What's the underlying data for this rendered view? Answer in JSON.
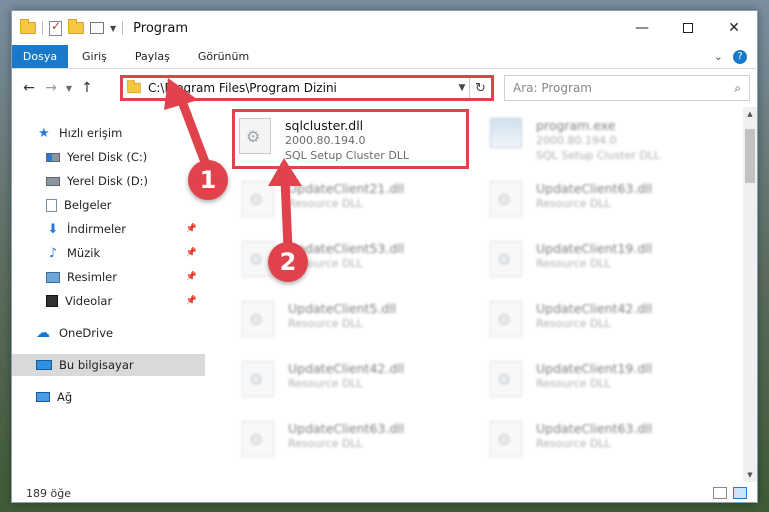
{
  "window": {
    "title": "Program",
    "minimize": "—",
    "close": "✕"
  },
  "ribbon": {
    "tabs": [
      "Dosya",
      "Giriş",
      "Paylaş",
      "Görünüm"
    ],
    "expand_icon": "chevron-down-icon",
    "help_label": "?"
  },
  "address": {
    "path": "C:\\Program Files\\Program Dizini",
    "back": "←",
    "forward": "→",
    "recent": "▼",
    "up": "↑",
    "dropdown": "▼",
    "refresh": "↻"
  },
  "search": {
    "placeholder": "Ara: Program",
    "icon": "⌕"
  },
  "nav": {
    "items": [
      {
        "label": "Hızlı erişim",
        "icon": "star-icon"
      },
      {
        "label": "Yerel Disk (C:)",
        "icon": "drive-icon"
      },
      {
        "label": "Yerel Disk (D:)",
        "icon": "drive-icon"
      },
      {
        "label": "Belgeler",
        "icon": "documents-icon"
      },
      {
        "label": "İndirmeler",
        "icon": "download-icon"
      },
      {
        "label": "Müzik",
        "icon": "music-icon"
      },
      {
        "label": "Resimler",
        "icon": "pictures-icon"
      },
      {
        "label": "Videolar",
        "icon": "video-icon"
      },
      {
        "label": "OneDrive",
        "icon": "cloud-icon"
      },
      {
        "label": "Bu bilgisayar",
        "icon": "computer-icon",
        "selected": true
      },
      {
        "label": "Ağ",
        "icon": "network-icon"
      }
    ],
    "pin": "📌"
  },
  "files": [
    {
      "name": "sqlcluster.dll",
      "version": "2000.80.194.0",
      "desc": "SQL Setup Cluster DLL",
      "highlight": true
    },
    {
      "name": "program.exe",
      "version": "2000.80.194.0",
      "desc": "SQL Setup Cluster DLL"
    },
    {
      "name": "UpdateClient21.dll",
      "desc": "Resource DLL"
    },
    {
      "name": "UpdateClient63.dll",
      "desc": "Resource DLL"
    },
    {
      "name": "UpdateClient53.dll",
      "desc": "Resource DLL"
    },
    {
      "name": "UpdateClient19.dll",
      "desc": "Resource DLL"
    },
    {
      "name": "UpdateClient5.dll",
      "desc": "Resource DLL"
    },
    {
      "name": "UpdateClient42.dll",
      "desc": "Resource DLL"
    },
    {
      "name": "UpdateClient42.dll",
      "desc": "Resource DLL"
    },
    {
      "name": "UpdateClient19.dll",
      "desc": "Resource DLL"
    },
    {
      "name": "UpdateClient63.dll",
      "desc": "Resource DLL"
    },
    {
      "name": "UpdateClient63.dll",
      "desc": "Resource DLL"
    }
  ],
  "status": {
    "count": "189 öğe"
  },
  "annotations": {
    "step1": "1",
    "step2": "2",
    "color": "#e0434b"
  },
  "colors": {
    "accent": "#1979ca",
    "highlight_border": "#e0434b"
  }
}
